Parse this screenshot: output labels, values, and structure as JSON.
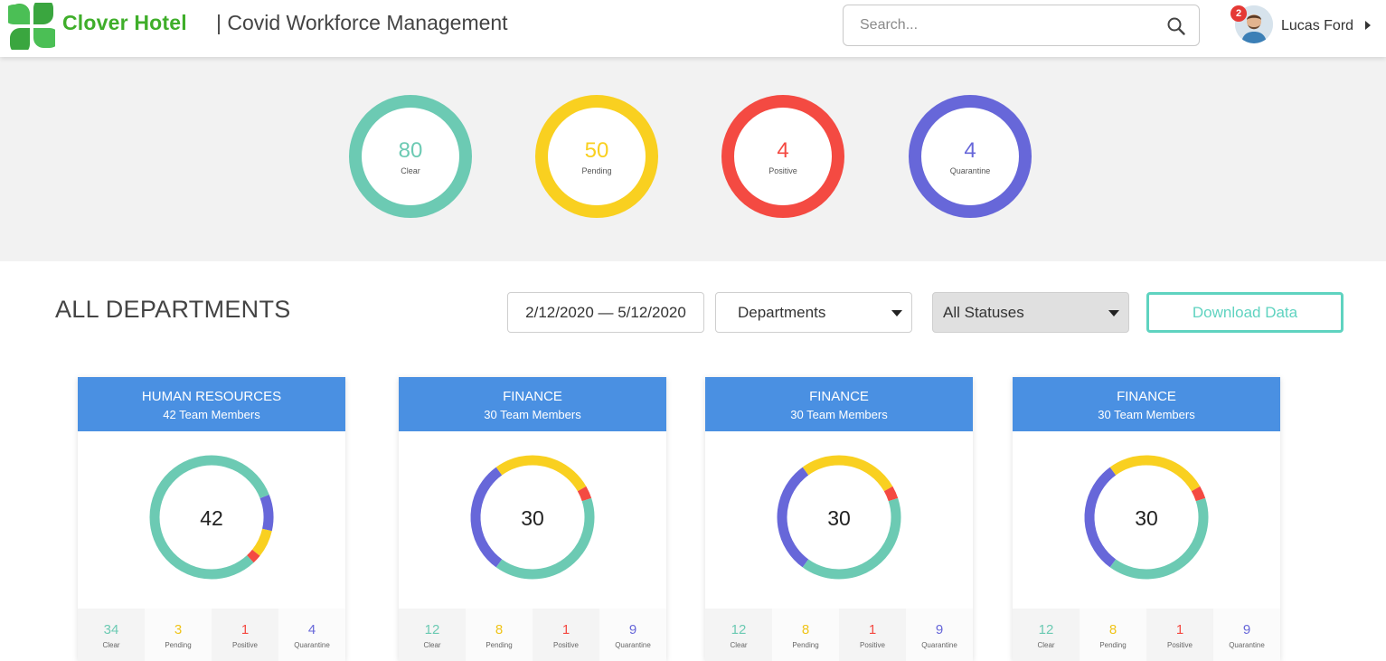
{
  "header": {
    "brand": "Clover Hotel",
    "subtitle": "| Covid Workforce Management",
    "search_placeholder": "Search...",
    "notification_count": "2",
    "user_name": "Lucas Ford"
  },
  "colors": {
    "clear": "#6ccab3",
    "pending": "#f9d020",
    "positive": "#f44a42",
    "quarantine": "#6767d9",
    "header_blue": "#4a90e2",
    "accent_teal": "#5fd3c0",
    "brand_green": "#3fae2a"
  },
  "summary": [
    {
      "value": "80",
      "label": "Clear",
      "color": "#6ccab3"
    },
    {
      "value": "50",
      "label": "Pending",
      "color": "#f9d020"
    },
    {
      "value": "4",
      "label": "Positive",
      "color": "#f44a42"
    },
    {
      "value": "4",
      "label": "Quarantine",
      "color": "#6767d9"
    }
  ],
  "filters": {
    "section_title": "ALL DEPARTMENTS",
    "date_range": "2/12/2020 — 5/12/2020",
    "department_select": "Departments",
    "status_select": "All Statuses",
    "download_label": "Download Data"
  },
  "departments": [
    {
      "name": "HUMAN RESOURCES",
      "members_label": "42 Team Members",
      "total": "42",
      "stats": {
        "clear": 34,
        "pending": 3,
        "positive": 1,
        "quarantine": 4
      },
      "stat_labels": {
        "clear": "Clear",
        "pending": "Pending",
        "positive": "Positive",
        "quarantine": "Quarantine"
      }
    },
    {
      "name": "FINANCE",
      "members_label": "30 Team Members",
      "total": "30",
      "stats": {
        "clear": 12,
        "pending": 8,
        "positive": 1,
        "quarantine": 9
      },
      "stat_labels": {
        "clear": "Clear",
        "pending": "Pending",
        "positive": "Positive",
        "quarantine": "Quarantine"
      }
    },
    {
      "name": "FINANCE",
      "members_label": "30 Team Members",
      "total": "30",
      "stats": {
        "clear": 12,
        "pending": 8,
        "positive": 1,
        "quarantine": 9
      },
      "stat_labels": {
        "clear": "Clear",
        "pending": "Pending",
        "positive": "Positive",
        "quarantine": "Quarantine"
      }
    },
    {
      "name": "FINANCE",
      "members_label": "30 Team Members",
      "total": "30",
      "stats": {
        "clear": 12,
        "pending": 8,
        "positive": 1,
        "quarantine": 9
      },
      "stat_labels": {
        "clear": "Clear",
        "pending": "Pending",
        "positive": "Positive",
        "quarantine": "Quarantine"
      }
    }
  ]
}
